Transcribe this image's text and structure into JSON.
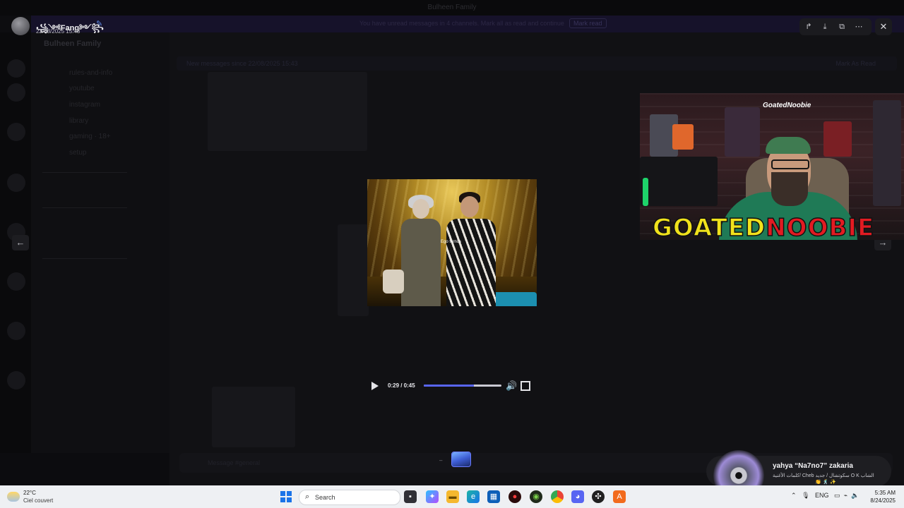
{
  "background": {
    "window_title": "Bulheen Family",
    "banner_text": "You have unread messages in 4 channels. Mark all as read and continue",
    "banner_button": "Mark read",
    "server_name": "Bulheen Family",
    "channels": [
      "rules-and-info",
      "youtube",
      "instagram",
      "library",
      "gaming · 18+",
      "setup"
    ],
    "pinned_text": "New messages since 22/08/2025 15:43",
    "pinned_action": "Mark As Read",
    "input_placeholder": "Message #general"
  },
  "viewer": {
    "author_name": "꧁༺Fang༻꧂",
    "author_badge_icon": "verified-icon",
    "posted_at": "22/08/2025 15:43",
    "actions": [
      {
        "name": "forward",
        "glyph": "↱"
      },
      {
        "name": "download",
        "glyph": "⤓"
      },
      {
        "name": "open-external",
        "glyph": "⧉"
      },
      {
        "name": "more",
        "glyph": "⋯"
      }
    ],
    "close_glyph": "✕",
    "prev_glyph": "←",
    "next_glyph": "→",
    "video": {
      "caption": "Ego ternos",
      "current_time": "0:29",
      "duration": "0:45",
      "time_display": "0:29 / 0:45",
      "progress": 0.644,
      "volume_glyph": "🔊"
    }
  },
  "stream_overlay": {
    "handle": "GoatedNoobie",
    "logo_part1": "GOATED",
    "logo_part2": "NOOBIE",
    "logo_color1": "#f1e21c",
    "logo_color2": "#e21b22"
  },
  "toast": {
    "title": "yahya “Na7no7” zakaria",
    "subtitle": "كلمات الأغنية/ Cheb سكوتشال / جديد O K الشاب",
    "emoji": "👏 🕺 ✨"
  },
  "taskbar": {
    "weather_temp": "22°C",
    "weather_condition": "Ciel couvert",
    "search_label": "Search",
    "language": "ENG",
    "time": "5:35 AM",
    "date": "8/24/2025",
    "accent": "#1a73e8"
  }
}
